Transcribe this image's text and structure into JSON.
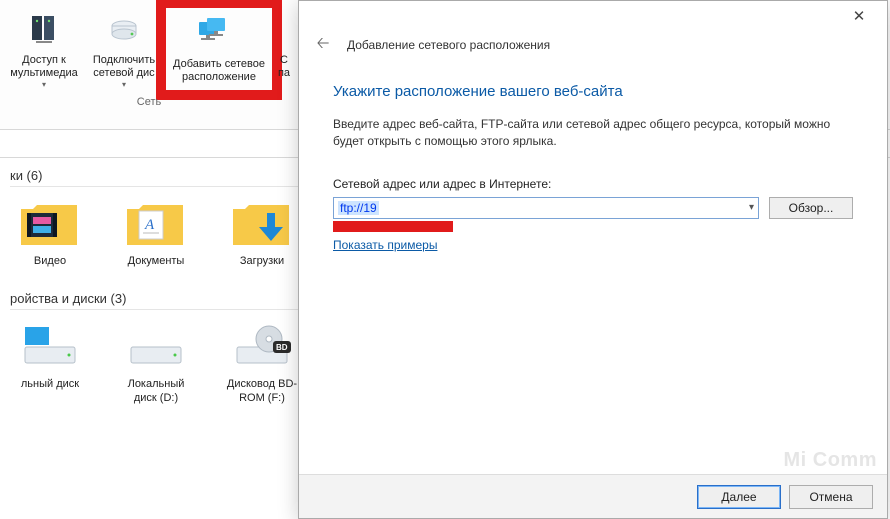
{
  "ribbon": {
    "group_label": "Сеть",
    "buttons": [
      {
        "label": "Доступ к мультимедиа",
        "icon": "media-server-icon"
      },
      {
        "label": "Подключить сетевой дис",
        "icon": "map-drive-icon"
      },
      {
        "label": "Добавить сетевое расположение",
        "icon": "add-network-location-icon"
      },
      {
        "label": "С па",
        "icon": "control-panel-icon"
      }
    ]
  },
  "sections": {
    "folders": {
      "title": "ки (6)",
      "items": [
        {
          "label": "Видео",
          "icon": "videos-folder-icon"
        },
        {
          "label": "Документы",
          "icon": "documents-folder-icon"
        },
        {
          "label": "Загрузки",
          "icon": "downloads-folder-icon"
        }
      ]
    },
    "drives": {
      "title": "ройства и диски (3)",
      "items": [
        {
          "label": "льный диск",
          "sub": "",
          "icon": "local-disk-icon",
          "accent": "#29a3e8"
        },
        {
          "label": "Локальный диск (D:)",
          "sub": "",
          "icon": "local-disk-icon",
          "accent": "#888"
        },
        {
          "label": "Дисковод BD-ROM (F:)",
          "sub": "",
          "icon": "bd-rom-icon",
          "accent": "#333"
        }
      ]
    }
  },
  "dialog": {
    "window_title": "Добавление сетевого расположения",
    "heading": "Укажите расположение вашего веб-сайта",
    "description": "Введите адрес веб-сайта, FTP-сайта или сетевой адрес общего ресурса, который можно будет открыть с помощью этого ярлыка.",
    "field_label": "Сетевой адрес или адрес в Интернете:",
    "field_value": "ftp://19",
    "browse": "Обзор...",
    "examples_link": "Показать примеры",
    "next": "Далее",
    "cancel": "Отмена"
  },
  "watermark": "Mi Comm"
}
